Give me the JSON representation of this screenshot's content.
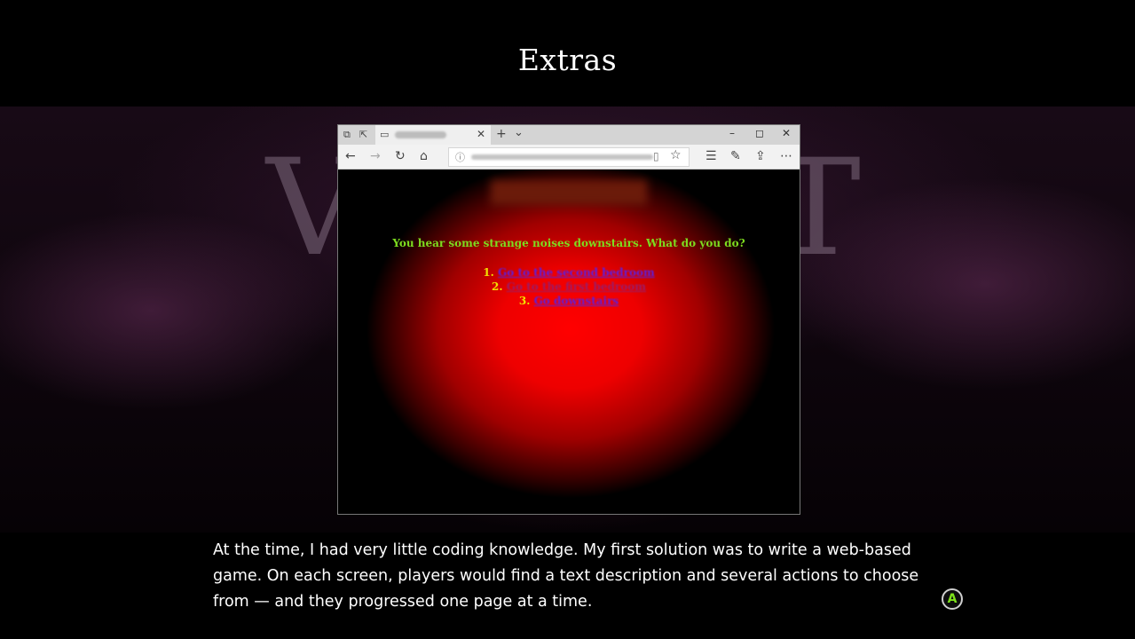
{
  "screen": {
    "title": "Extras",
    "watermark": {
      "left": "V",
      "right": "T"
    },
    "caption": "At the time, I had very little coding knowledge. My first solution was to write a web-based game. On each screen, players would find a text description and several actions to choose from — and they progressed one page at a time.",
    "confirm_button": {
      "label": "A",
      "icon": "a-button-icon",
      "color": "#7ee21b"
    }
  },
  "browser": {
    "tabbar": {
      "icons": {
        "tabs_aside": "⧉",
        "set_aside": "⇱",
        "tab_page": "▭"
      },
      "new_tab": "+",
      "tab_list": "⌄",
      "tab_close": "✕",
      "window": {
        "minimize": "–",
        "maximize": "◻",
        "close": "✕"
      }
    },
    "toolbar": {
      "back": "←",
      "forward": "→",
      "refresh": "↻",
      "home": "⌂",
      "info": "ⓘ",
      "reading_view": "▯",
      "favorite": "☆",
      "favorites_hub": "☰",
      "notes": "✎",
      "share": "⇪",
      "more": "⋯"
    }
  },
  "game": {
    "question": "You hear some strange noises downstairs. What do you do?",
    "choices": [
      {
        "number": "1.",
        "label": "Go to the second bedroom",
        "visited": false
      },
      {
        "number": "2.",
        "label": "Go to the first bedroom",
        "visited": true
      },
      {
        "number": "3.",
        "label": "Go downstairs",
        "visited": false
      }
    ],
    "colors": {
      "question": "#7ddc1f",
      "numbers": "#f2e000",
      "link": "#5a1fe0",
      "visited_link": "#9b1b66",
      "background": "#ff0000"
    }
  }
}
